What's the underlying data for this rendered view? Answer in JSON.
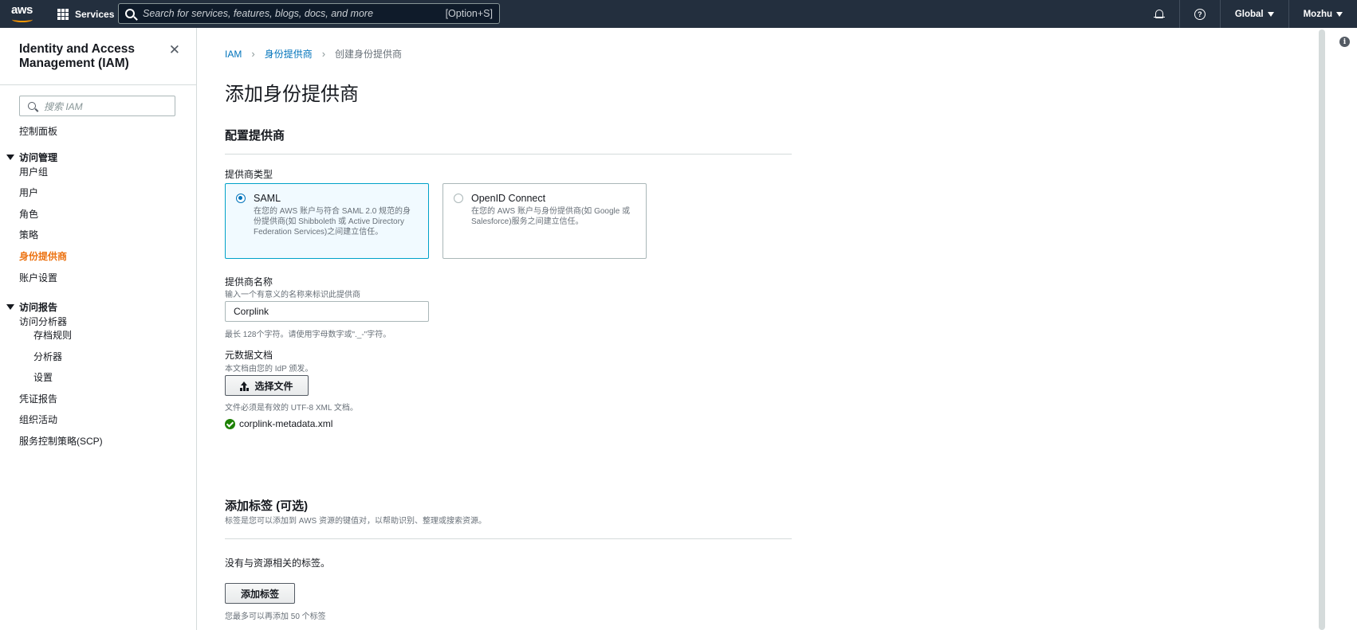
{
  "topnav": {
    "logo_text": "aws",
    "services_label": "Services",
    "search_placeholder": "Search for services, features, blogs, docs, and more",
    "search_shortcut": "[Option+S]",
    "region_label": "Global",
    "account_label": "Mozhu"
  },
  "sidebar": {
    "title": "Identity and Access Management (IAM)",
    "search_placeholder": "搜索 IAM",
    "dashboard": "控制面板",
    "access_mgmt": {
      "label": "访问管理",
      "items": [
        "用户组",
        "用户",
        "角色",
        "策略",
        "身份提供商",
        "账户设置"
      ]
    },
    "access_reports": {
      "label": "访问报告",
      "analyzer": "访问分析器",
      "analyzer_items": [
        "存档规则",
        "分析器",
        "设置"
      ],
      "items": [
        "凭证报告",
        "组织活动",
        "服务控制策略(SCP)"
      ]
    },
    "active_item": "身份提供商"
  },
  "breadcrumb": {
    "root": "IAM",
    "parent": "身份提供商",
    "current": "创建身份提供商"
  },
  "page": {
    "title": "添加身份提供商",
    "configure_title": "配置提供商",
    "provider_type_label": "提供商类型",
    "provider_types": [
      {
        "title": "SAML",
        "desc": "在您的 AWS 账户与符合 SAML 2.0 规范的身份提供商(如 Shibboleth 或 Active Directory Federation Services)之间建立信任。",
        "selected": true
      },
      {
        "title": "OpenID Connect",
        "desc": "在您的 AWS 账户与身份提供商(如 Google 或 Salesforce)服务之间建立信任。",
        "selected": false
      }
    ],
    "provider_name_label": "提供商名称",
    "provider_name_desc": "输入一个有意义的名称来标识此提供商",
    "provider_name_value": "Corplink",
    "provider_name_hint": "最长 128个字符。请使用字母数字或\"._-\"字符。",
    "metadata_label": "元数据文档",
    "metadata_desc": "本文档由您的 IdP 颁发。",
    "choose_file_label": "选择文件",
    "metadata_hint": "文件必须是有效的 UTF-8 XML 文档。",
    "uploaded_file": "corplink-metadata.xml",
    "tags_title": "添加标签 (可选)",
    "tags_desc": "标签是您可以添加到 AWS 资源的键值对，以帮助识别、整理或搜索资源。",
    "no_tags": "没有与资源相关的标签。",
    "add_tag_label": "添加标签",
    "tags_limit": "您最多可以再添加 50 个标签"
  },
  "colors": {
    "nav_bg": "#232f3e",
    "accent_orange": "#ec7211",
    "link_blue": "#0073bb",
    "success_green": "#1d8102"
  }
}
